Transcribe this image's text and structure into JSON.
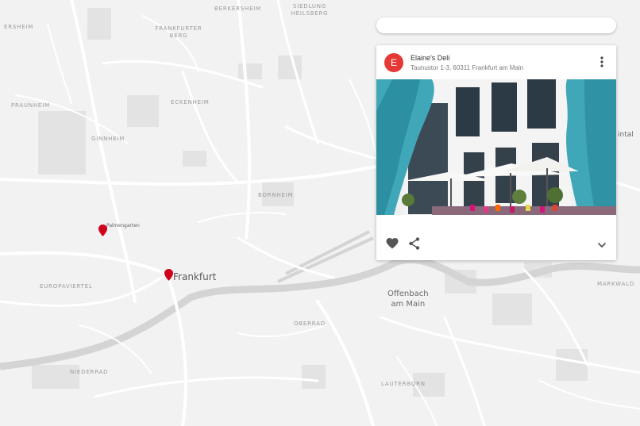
{
  "map": {
    "district_labels": [
      "BERKERSHEIM",
      "SIEDLUNG HEILSBERG",
      "ERSHEIM",
      "FRANKFURTER BERG",
      "PRAUNHEIM",
      "ECKENHEIM",
      "GINNHEIM",
      "BORNHEIM",
      "EUROPAVIERTEL",
      "OBERRAD",
      "NIEDERRAD",
      "LAUTERBORN",
      "MARKWALD"
    ],
    "city_label": "Frankfurt",
    "offenbach_label": "Offenbach\nam Main",
    "palmengarten_label": "Palmengarten",
    "edge_label": "intal"
  },
  "search": {
    "value": "",
    "placeholder": ""
  },
  "card": {
    "avatar_letter": "E",
    "title": "Elaine's Deli",
    "address": "Taunustor 1-3, 60311 Frankfurt am Main"
  },
  "icons": {
    "more": "more-vert-icon",
    "favorite": "heart-icon",
    "share": "share-icon",
    "expand": "chevron-down-icon"
  },
  "colors": {
    "pin": "#d0021b",
    "avatar": "#e53935"
  }
}
